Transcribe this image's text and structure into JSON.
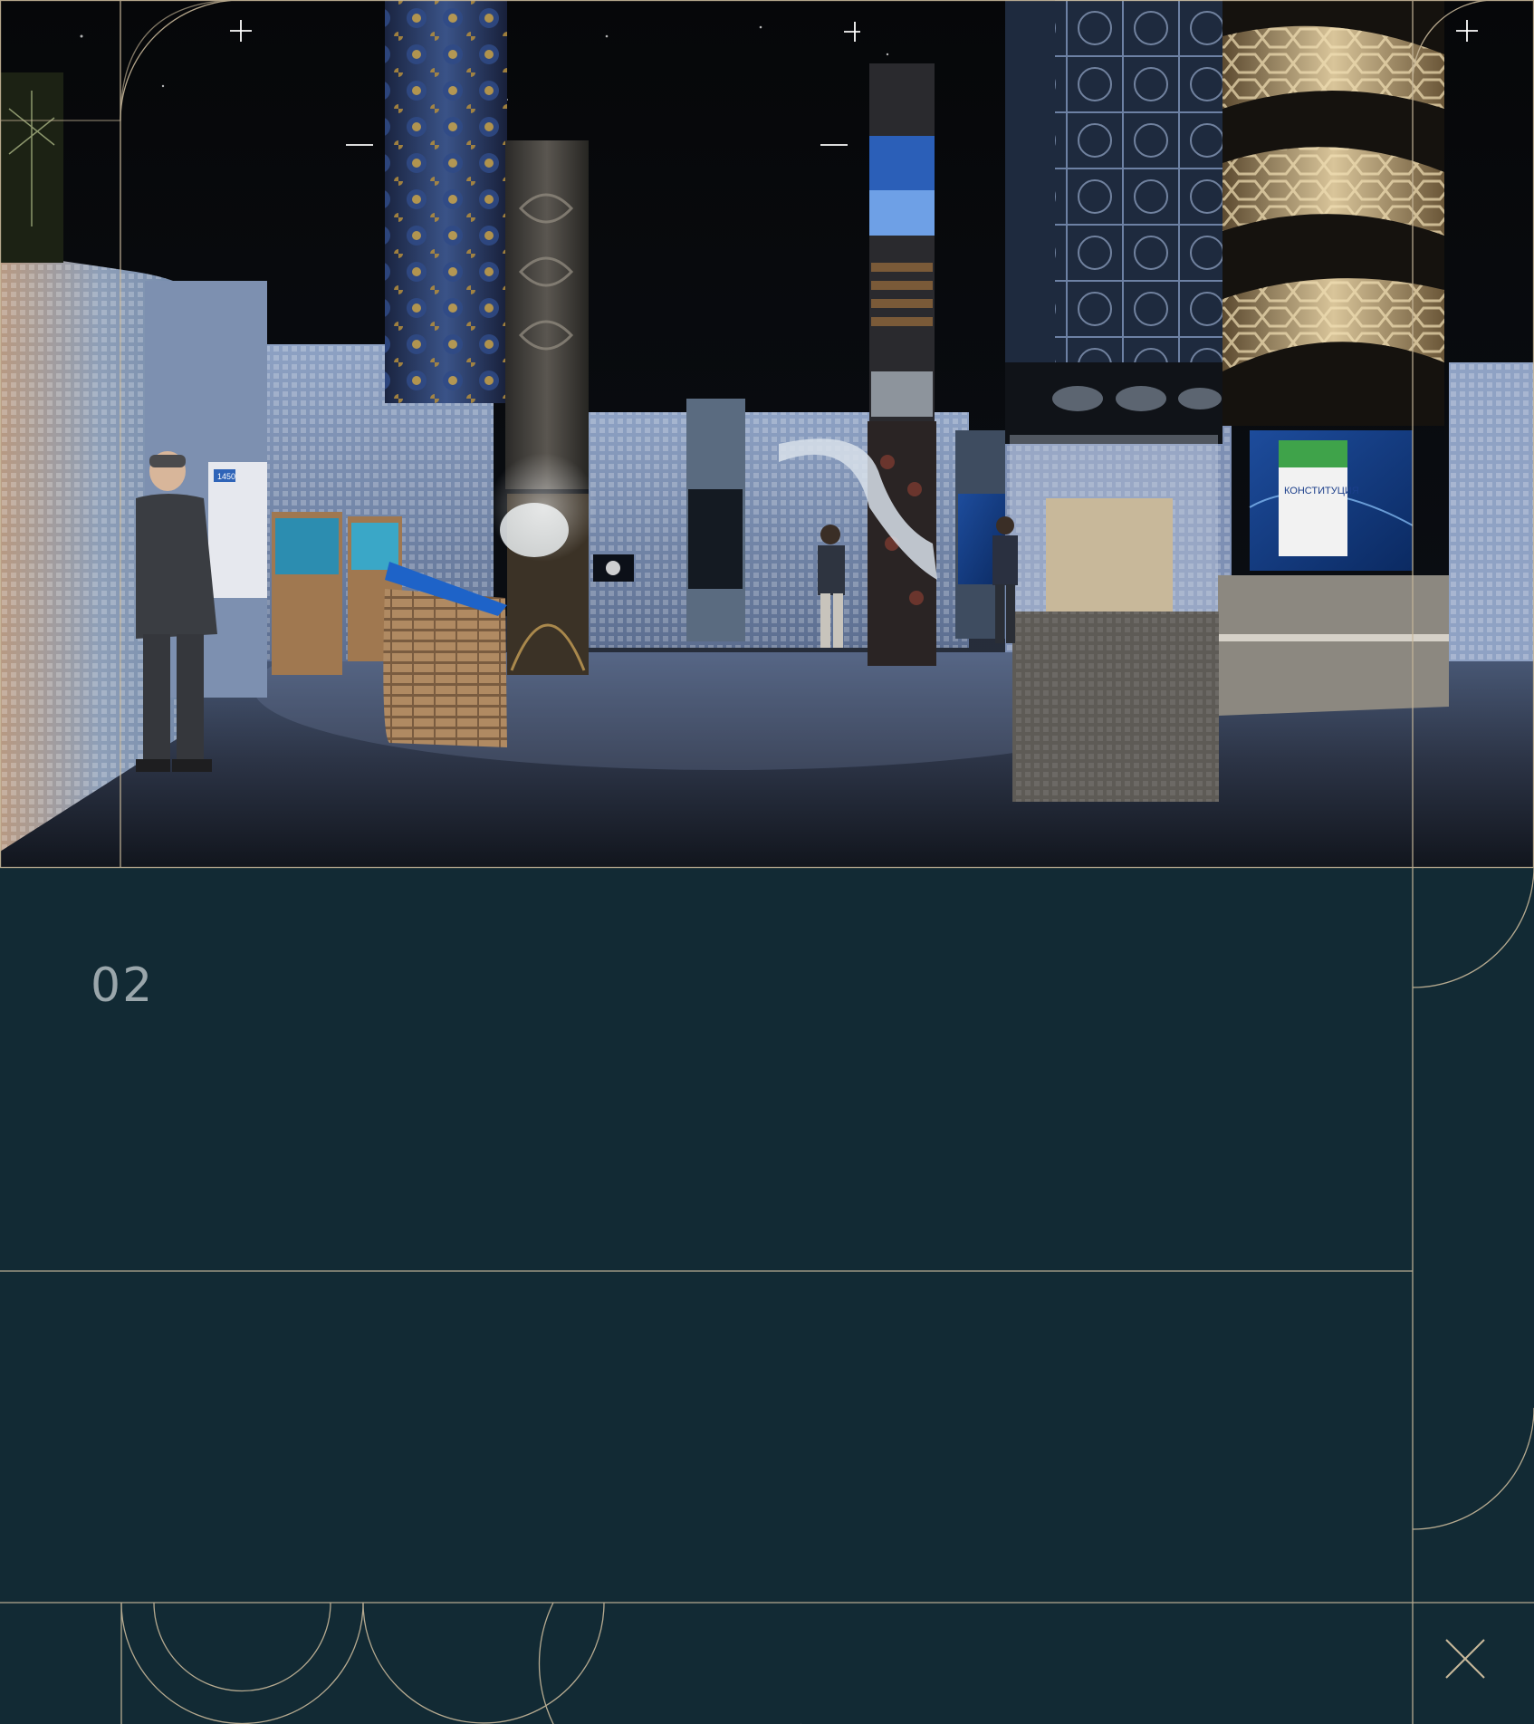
{
  "section": {
    "number": "02"
  },
  "render": {
    "wall_screens": [
      "1450"
    ],
    "constitution_panel": "КОНСТИТУЦИЯ"
  },
  "colors": {
    "background": "#122a34",
    "frame_line": "#c8b89a",
    "number_text": "#9aa6ab"
  },
  "icons": {
    "close": "close-icon"
  }
}
